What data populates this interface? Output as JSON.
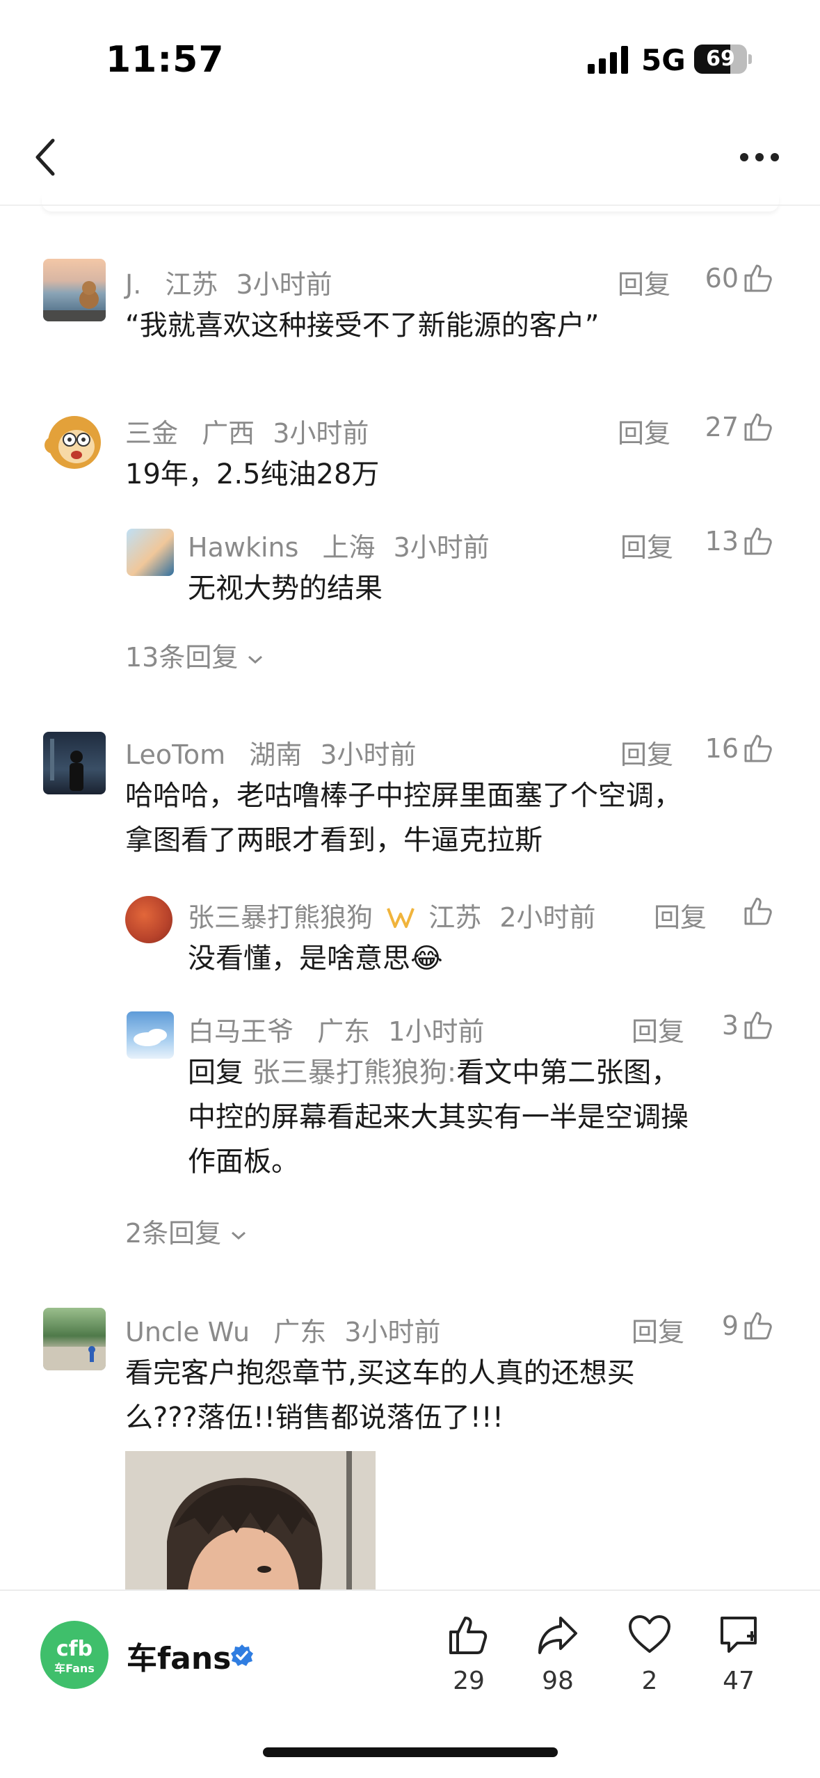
{
  "status_bar": {
    "time": "11:57",
    "network": "5G",
    "battery": "69",
    "battery_level": 0.69
  },
  "comments": [
    {
      "user": "J.",
      "location": "江苏",
      "time": "3小时前",
      "reply_label": "回复",
      "likes": "60",
      "text": [
        "“我就喜欢这种接受不了新能源的客户”"
      ]
    },
    {
      "user": "三金",
      "location": "广西",
      "time": "3小时前",
      "reply_label": "回复",
      "likes": "27",
      "text": [
        "19年，2.5纯油28万"
      ],
      "replies": [
        {
          "user": "Hawkins",
          "location": "上海",
          "time": "3小时前",
          "reply_label": "回复",
          "likes": "13",
          "text": [
            "无视大势的结果"
          ]
        }
      ],
      "more_replies": "13条回复"
    },
    {
      "user": "LeoTom",
      "location": "湖南",
      "time": "3小时前",
      "reply_label": "回复",
      "likes": "16",
      "text": [
        "哈哈哈，老咕噜棒子中控屏里面塞了个空调，",
        "拿图看了两眼才看到，牛逼克拉斯"
      ],
      "replies": [
        {
          "user": "张三暴打熊狼狗",
          "location": "江苏",
          "time": "2小时前",
          "reply_label": "回复",
          "likes": "",
          "text": [
            "没看懂，是啥意思😂"
          ]
        },
        {
          "user": "白马王爷",
          "location": "广东",
          "time": "1小时前",
          "reply_label": "回复",
          "likes": "3",
          "reply_prefix": "回复",
          "mention": "张三暴打熊狼狗:",
          "text": [
            "看文中第二张图，",
            "中控的屏幕看起来大其实有一半是空调操",
            "作面板。"
          ]
        }
      ],
      "more_replies": "2条回复"
    },
    {
      "user": "Uncle Wu",
      "location": "广东",
      "time": "3小时前",
      "reply_label": "回复",
      "likes": "9",
      "text": [
        "看完客户抱怨章节,买这车的人真的还想买",
        "么???落伍!!销售都说落伍了!!!"
      ]
    }
  ],
  "footer": {
    "brand": "车fans",
    "logo_text": "车Fans",
    "like_count": "29",
    "share_count": "98",
    "fav_count": "2",
    "comment_count": "47"
  }
}
